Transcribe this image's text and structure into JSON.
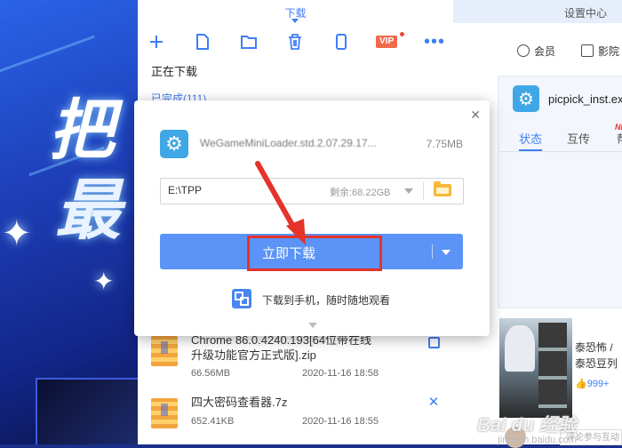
{
  "panel": {
    "active_tab": "下载",
    "section_downloading": "正在下载",
    "section_completed": "已完成(111)",
    "toolbar": {
      "icons": [
        "plus-icon",
        "file-icon",
        "folder-icon",
        "trash-icon",
        "phone-icon",
        "vip-icon",
        "more-icon"
      ],
      "vip_label": "VIP"
    }
  },
  "files": [
    {
      "name": "Chrome 86.0.4240.193[64位带在线升级功能官方正式版].zip",
      "size": "66.56MB",
      "date": "2020-11-16 18:58"
    },
    {
      "name": "四大密码查看器.7z",
      "size": "652.41KB",
      "date": "2020-11-16 18:55"
    }
  ],
  "popup": {
    "file_name": "WeGameMiniLoader.std.2.07.29.17...",
    "file_size": "7.75MB",
    "path": "E:\\TPP",
    "free_space": "剩余:68.22GB",
    "download_button": "立即下载",
    "phone_download": "下载到手机，随时随地观看"
  },
  "right": {
    "settings_tab": "设置中心",
    "nav_member": "会员",
    "nav_movie": "影院",
    "card_title": "picpick_inst.ex",
    "tab_status": "状态",
    "tab_share": "互传",
    "new_badge": "NEW",
    "tab_help": "帮",
    "movie_title_1": "泰恐怖 /",
    "movie_title_2": "泰恐豆列",
    "likes": "999+",
    "comment_placeholder": "评论参与互动"
  },
  "background": {
    "char_1": "把",
    "char_2": "最"
  },
  "watermark": {
    "brand": "Bai du 经验",
    "url": "jingyan.baidu.com"
  }
}
